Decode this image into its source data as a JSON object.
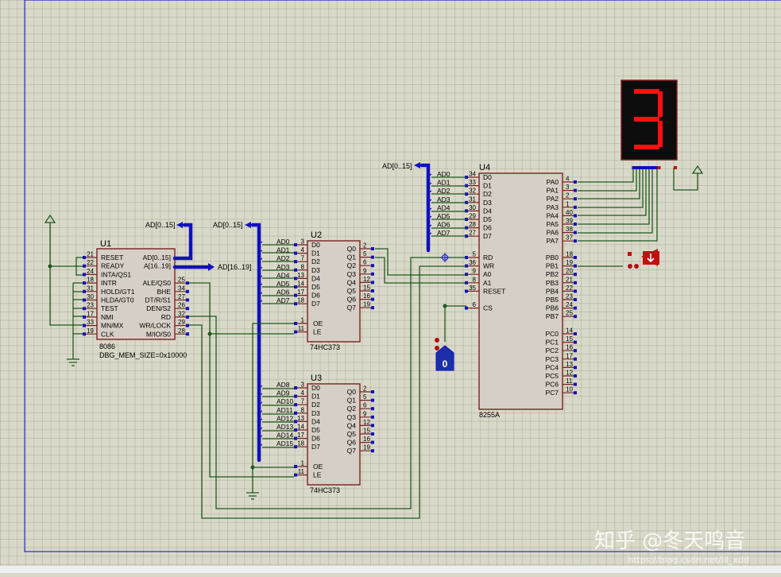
{
  "u1": {
    "ref": "U1",
    "type": "8086",
    "property": "DBG_MEM_SIZE=0x10000",
    "left_pins": [
      {
        "name": "RESET",
        "num": "21"
      },
      {
        "name": "READY",
        "num": "22"
      },
      {
        "name": "INTA/QS1",
        "num": "24"
      },
      {
        "name": "INTR",
        "num": "18"
      },
      {
        "name": "HOLD/GT1",
        "num": "31"
      },
      {
        "name": "HLDA/GT0",
        "num": "30"
      },
      {
        "name": "TEST",
        "num": "23"
      },
      {
        "name": "NMI",
        "num": "17"
      },
      {
        "name": "MN/MX",
        "num": "33"
      },
      {
        "name": "CLK",
        "num": "19"
      }
    ],
    "right_pins": [
      {
        "name": "AD[0..15]",
        "num": ""
      },
      {
        "name": "A[16..19]",
        "num": ""
      },
      {
        "name": "",
        "num": ""
      },
      {
        "name": "ALE/QS0",
        "num": "25"
      },
      {
        "name": "BHE",
        "num": "34"
      },
      {
        "name": "DT/R/S1",
        "num": "27"
      },
      {
        "name": "DEN/S2",
        "num": "26"
      },
      {
        "name": "RD",
        "num": "32"
      },
      {
        "name": "WR/LOCK",
        "num": "29"
      },
      {
        "name": "M/IO/S0",
        "num": "28"
      }
    ]
  },
  "u2": {
    "ref": "U2",
    "type": "74HC373",
    "inputs": [
      {
        "net": "AD0",
        "num": "3",
        "name": "D0"
      },
      {
        "net": "AD1",
        "num": "4",
        "name": "D1"
      },
      {
        "net": "AD2",
        "num": "7",
        "name": "D2"
      },
      {
        "net": "AD3",
        "num": "8",
        "name": "D3"
      },
      {
        "net": "AD4",
        "num": "13",
        "name": "D4"
      },
      {
        "net": "AD5",
        "num": "14",
        "name": "D5"
      },
      {
        "net": "AD6",
        "num": "17",
        "name": "D6"
      },
      {
        "net": "AD7",
        "num": "18",
        "name": "D7"
      }
    ],
    "outputs": [
      {
        "name": "Q0",
        "num": "2"
      },
      {
        "name": "Q1",
        "num": "5"
      },
      {
        "name": "Q2",
        "num": "6"
      },
      {
        "name": "Q3",
        "num": "9"
      },
      {
        "name": "Q4",
        "num": "12"
      },
      {
        "name": "Q5",
        "num": "15"
      },
      {
        "name": "Q6",
        "num": "16"
      },
      {
        "name": "Q7",
        "num": "19"
      }
    ],
    "control": [
      {
        "name": "OE",
        "num": "1"
      },
      {
        "name": "LE",
        "num": "11"
      }
    ]
  },
  "u3": {
    "ref": "U3",
    "type": "74HC373",
    "inputs": [
      {
        "net": "AD8",
        "num": "3",
        "name": "D0"
      },
      {
        "net": "AD9",
        "num": "4",
        "name": "D1"
      },
      {
        "net": "AD10",
        "num": "7",
        "name": "D2"
      },
      {
        "net": "AD11",
        "num": "8",
        "name": "D3"
      },
      {
        "net": "AD12",
        "num": "13",
        "name": "D4"
      },
      {
        "net": "AD13",
        "num": "14",
        "name": "D5"
      },
      {
        "net": "AD14",
        "num": "17",
        "name": "D6"
      },
      {
        "net": "AD15",
        "num": "18",
        "name": "D7"
      }
    ],
    "outputs": [
      {
        "name": "Q0",
        "num": "2"
      },
      {
        "name": "Q1",
        "num": "5"
      },
      {
        "name": "Q2",
        "num": "6"
      },
      {
        "name": "Q3",
        "num": "9"
      },
      {
        "name": "Q4",
        "num": "12"
      },
      {
        "name": "Q5",
        "num": "15"
      },
      {
        "name": "Q6",
        "num": "16"
      },
      {
        "name": "Q7",
        "num": "19"
      }
    ],
    "control": [
      {
        "name": "OE",
        "num": "1"
      },
      {
        "name": "LE",
        "num": "11"
      }
    ]
  },
  "u4": {
    "ref": "U4",
    "type": "8255A",
    "data_pins": [
      {
        "net": "AD0",
        "num": "34",
        "name": "D0"
      },
      {
        "net": "AD1",
        "num": "33",
        "name": "D1"
      },
      {
        "net": "AD2",
        "num": "32",
        "name": "D2"
      },
      {
        "net": "AD3",
        "num": "31",
        "name": "D3"
      },
      {
        "net": "AD4",
        "num": "30",
        "name": "D4"
      },
      {
        "net": "AD5",
        "num": "29",
        "name": "D5"
      },
      {
        "net": "AD6",
        "num": "28",
        "name": "D6"
      },
      {
        "net": "AD7",
        "num": "27",
        "name": "D7"
      }
    ],
    "ctrl_pins": [
      {
        "name": "RD",
        "num": "5"
      },
      {
        "name": "WR",
        "num": "36"
      },
      {
        "name": "A0",
        "num": "9"
      },
      {
        "name": "A1",
        "num": "8"
      },
      {
        "name": "RESET",
        "num": "35"
      },
      {
        "name": "",
        "num": ""
      },
      {
        "name": "CS",
        "num": "6"
      }
    ],
    "port_a": [
      {
        "name": "PA0",
        "num": "4"
      },
      {
        "name": "PA1",
        "num": "3"
      },
      {
        "name": "PA2",
        "num": "2"
      },
      {
        "name": "PA3",
        "num": "1"
      },
      {
        "name": "PA4",
        "num": "40"
      },
      {
        "name": "PA5",
        "num": "39"
      },
      {
        "name": "PA6",
        "num": "38"
      },
      {
        "name": "PA7",
        "num": "37"
      }
    ],
    "port_b": [
      {
        "name": "PB0",
        "num": "18"
      },
      {
        "name": "PB1",
        "num": "19"
      },
      {
        "name": "PB2",
        "num": "20"
      },
      {
        "name": "PB3",
        "num": "21"
      },
      {
        "name": "PB4",
        "num": "22"
      },
      {
        "name": "PB5",
        "num": "23"
      },
      {
        "name": "PB6",
        "num": "24"
      },
      {
        "name": "PB7",
        "num": "25"
      }
    ],
    "port_c": [
      {
        "name": "PC0",
        "num": "14"
      },
      {
        "name": "PC1",
        "num": "15"
      },
      {
        "name": "PC2",
        "num": "16"
      },
      {
        "name": "PC3",
        "num": "17"
      },
      {
        "name": "PC4",
        "num": "13"
      },
      {
        "name": "PC5",
        "num": "12"
      },
      {
        "name": "PC6",
        "num": "11"
      },
      {
        "name": "PC7",
        "num": "10"
      }
    ]
  },
  "buses": {
    "b1": "AD[0..15]",
    "b2": "AD[16..19]",
    "b3": "AD[0..15]",
    "b4": "AD[0..15]"
  },
  "display": {
    "digit": "3",
    "segment_color": "#ff1010"
  },
  "logic_state": {
    "value": "0"
  },
  "watermark": {
    "main": "知乎 @冬天鸣音",
    "url": "https://blog.csdn.net/lil_xdd"
  },
  "colors": {
    "wire": "#1d5a1d",
    "bus": "#1010c0",
    "chip_fill": "#d6cfc5",
    "chip_border": "#7a2020",
    "pin_end": "#c01010"
  }
}
